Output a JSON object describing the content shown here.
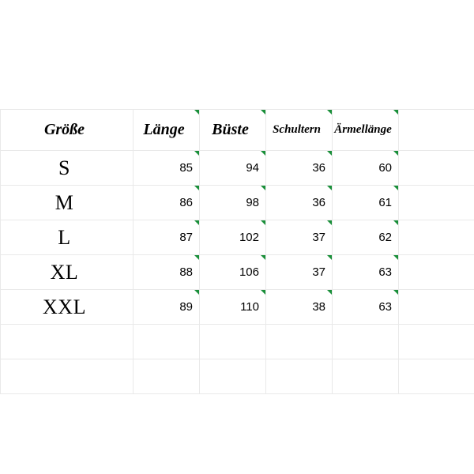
{
  "headers": {
    "size": "Größe",
    "length": "Länge",
    "bust": "Büste",
    "shoulders": "Schultern",
    "sleeve": "Ärmellänge"
  },
  "rows": [
    {
      "size": "S",
      "length": "85",
      "bust": "94",
      "shoulders": "36",
      "sleeve": "60"
    },
    {
      "size": "M",
      "length": "86",
      "bust": "98",
      "shoulders": "36",
      "sleeve": "61"
    },
    {
      "size": "L",
      "length": "87",
      "bust": "102",
      "shoulders": "37",
      "sleeve": "62"
    },
    {
      "size": "XL",
      "length": "88",
      "bust": "106",
      "shoulders": "37",
      "sleeve": "63"
    },
    {
      "size": "XXL",
      "length": "89",
      "bust": "110",
      "shoulders": "38",
      "sleeve": "63"
    }
  ],
  "chart_data": {
    "type": "table",
    "title": "",
    "columns": [
      "Größe",
      "Länge",
      "Büste",
      "Schultern",
      "Ärmellänge"
    ],
    "rows": [
      [
        "S",
        85,
        94,
        36,
        60
      ],
      [
        "M",
        86,
        98,
        36,
        61
      ],
      [
        "L",
        87,
        102,
        37,
        62
      ],
      [
        "XL",
        88,
        106,
        37,
        63
      ],
      [
        "XXL",
        89,
        110,
        38,
        63
      ]
    ]
  }
}
